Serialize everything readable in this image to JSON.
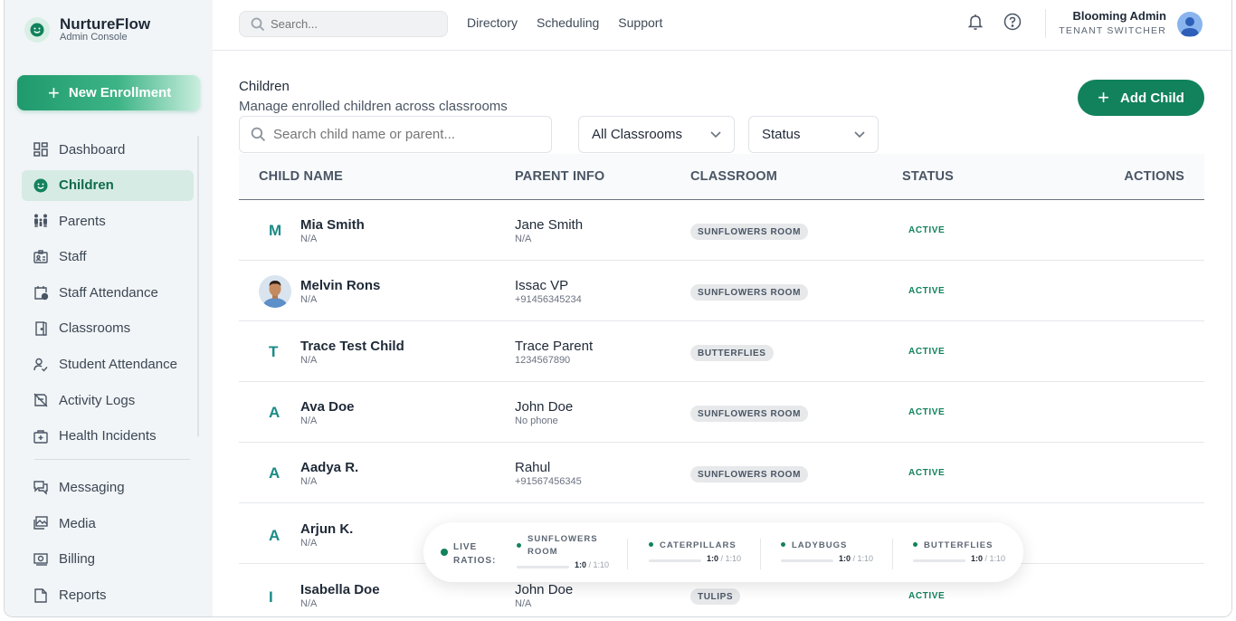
{
  "brand": {
    "name": "NurtureFlow",
    "subtitle": "Admin Console"
  },
  "sidebar": {
    "new_enrollment": "New Enrollment",
    "items": [
      {
        "label": "Dashboard",
        "icon": "dashboard-icon"
      },
      {
        "label": "Children",
        "icon": "child-face-icon",
        "active": true
      },
      {
        "label": "Parents",
        "icon": "family-icon"
      },
      {
        "label": "Staff",
        "icon": "badge-icon"
      },
      {
        "label": "Staff Attendance",
        "icon": "calendar-clock-icon"
      },
      {
        "label": "Classrooms",
        "icon": "door-icon"
      },
      {
        "label": "Student Attendance",
        "icon": "user-check-icon"
      },
      {
        "label": "Activity Logs",
        "icon": "log-icon"
      },
      {
        "label": "Health Incidents",
        "icon": "medical-kit-icon"
      },
      {
        "label": "Messaging",
        "icon": "chat-icon"
      },
      {
        "label": "Media",
        "icon": "image-icon"
      },
      {
        "label": "Billing",
        "icon": "money-icon"
      },
      {
        "label": "Reports",
        "icon": "report-icon"
      }
    ]
  },
  "topbar": {
    "search_placeholder": "Search...",
    "links": [
      "Directory",
      "Scheduling",
      "Support"
    ],
    "user_name": "Blooming Admin",
    "user_sub": "TENANT SWITCHER"
  },
  "page": {
    "title": "Children",
    "subtitle": "Manage enrolled children across classrooms",
    "add_button": "Add Child",
    "search_placeholder": "Search child name or parent...",
    "classroom_filter": "All Classrooms",
    "status_filter": "Status"
  },
  "table": {
    "headers": [
      "CHILD NAME",
      "PARENT INFO",
      "CLASSROOM",
      "STATUS",
      "ACTIONS"
    ],
    "rows": [
      {
        "initial": "M",
        "name": "Mia Smith",
        "sub": "N/A",
        "parent": "Jane Smith",
        "parent_sub": "N/A",
        "room": "SUNFLOWERS ROOM",
        "status": "ACTIVE"
      },
      {
        "initial": "",
        "name": "Melvin Rons",
        "sub": "N/A",
        "parent": "Issac VP",
        "parent_sub": "+91456345234",
        "room": "SUNFLOWERS ROOM",
        "status": "ACTIVE",
        "photo": true
      },
      {
        "initial": "T",
        "name": "Trace Test Child",
        "sub": "N/A",
        "parent": "Trace Parent",
        "parent_sub": "1234567890",
        "room": "BUTTERFLIES",
        "status": "ACTIVE"
      },
      {
        "initial": "A",
        "name": "Ava Doe",
        "sub": "N/A",
        "parent": "John Doe",
        "parent_sub": "No phone",
        "room": "SUNFLOWERS ROOM",
        "status": "ACTIVE"
      },
      {
        "initial": "A",
        "name": "Aadya R.",
        "sub": "N/A",
        "parent": "Rahul",
        "parent_sub": "+91567456345",
        "room": "SUNFLOWERS ROOM",
        "status": "ACTIVE"
      },
      {
        "initial": "A",
        "name": "Arjun K.",
        "sub": "N/A",
        "parent": "",
        "parent_sub": "",
        "room": "",
        "status": ""
      },
      {
        "initial": "I",
        "name": "Isabella Doe",
        "sub": "N/A",
        "parent": "John Doe",
        "parent_sub": "N/A",
        "room": "TULIPS",
        "status": "ACTIVE"
      }
    ]
  },
  "live_ratios": {
    "label": "LIVE RATIOS:",
    "rooms": [
      {
        "name": "SUNFLOWERS ROOM",
        "current": "1:0",
        "limit": "/ 1:10"
      },
      {
        "name": "CATERPILLARS",
        "current": "1:0",
        "limit": "/ 1:10"
      },
      {
        "name": "LADYBUGS",
        "current": "1:0",
        "limit": "/ 1:10"
      },
      {
        "name": "BUTTERFLIES",
        "current": "1:0",
        "limit": "/ 1:10"
      }
    ]
  },
  "colors": {
    "accent": "#12825c",
    "sidebar_bg": "#f1f5f7",
    "active_bg": "#d6ebe3"
  }
}
